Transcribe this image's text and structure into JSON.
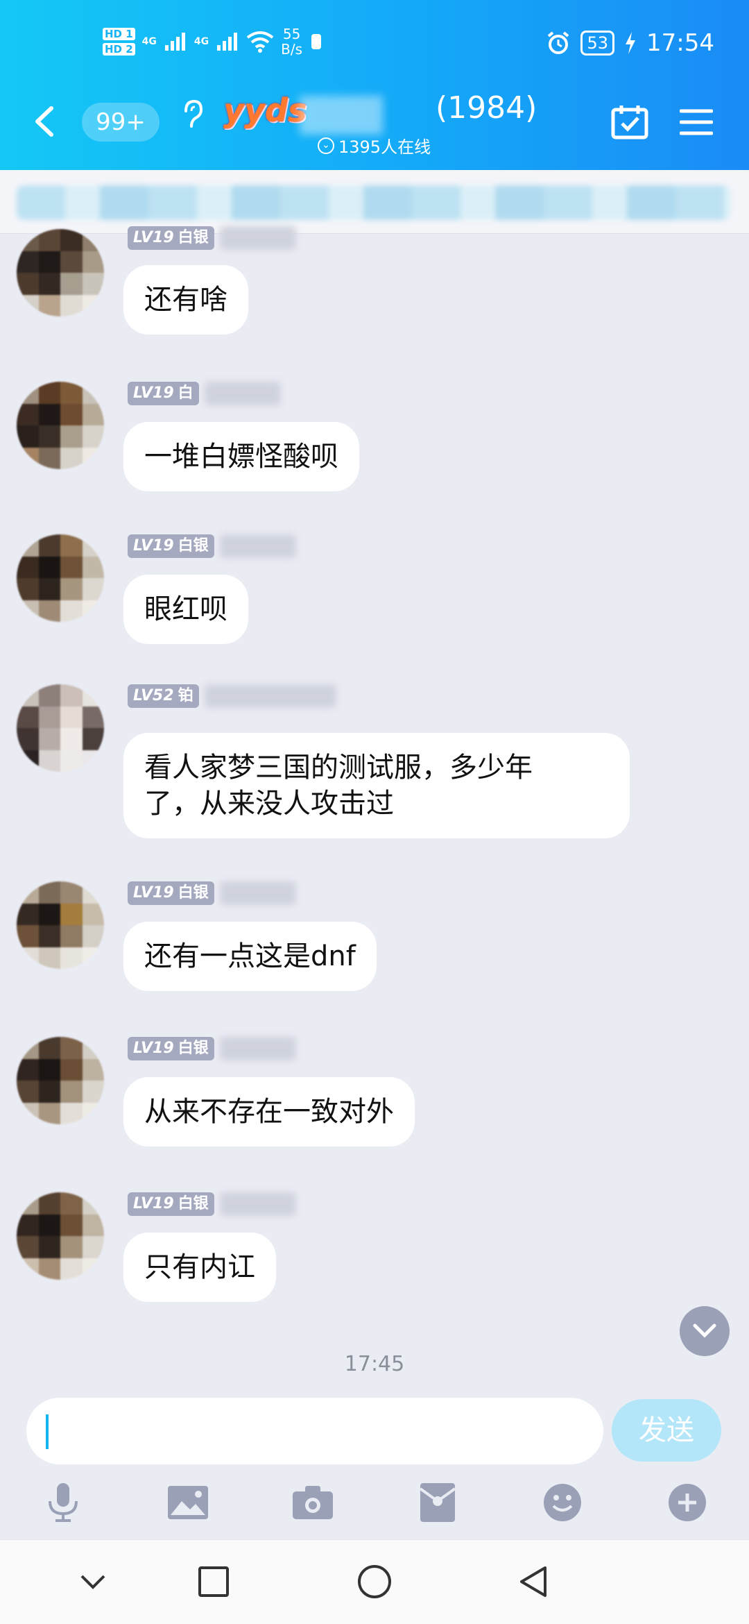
{
  "status_bar": {
    "hd1": "HD 1",
    "hd2": "HD 2",
    "net1": "4G",
    "net2": "4G",
    "speed_value": "55",
    "speed_unit": "B/s",
    "battery": "53",
    "time": "17:54"
  },
  "header": {
    "unread_badge": "99+",
    "group_logo": "yyds",
    "member_count": "(1984)",
    "online_text": "1395人在线"
  },
  "messages": [
    {
      "level": "LV19",
      "rank": "白银",
      "text": "还有啥"
    },
    {
      "level": "LV19",
      "rank": "白",
      "text": "一堆白嫖怪酸呗"
    },
    {
      "level": "LV19",
      "rank": "白银",
      "text": "眼红呗"
    },
    {
      "level": "LV52",
      "rank": "铂",
      "text_line1": "看人家梦三国的测试服，多少年",
      "text_line2": "了，从来没人攻击过"
    },
    {
      "level": "LV19",
      "rank": "白银",
      "text": "还有一点这是dnf"
    },
    {
      "level": "LV19",
      "rank": "白银",
      "text": "从来不存在一致对外"
    },
    {
      "level": "LV19",
      "rank": "白银",
      "text": "只有内讧"
    }
  ],
  "timestamp": "17:45",
  "input": {
    "value": "",
    "send_label": "发送"
  },
  "toolbar_icons": [
    "microphone-icon",
    "image-icon",
    "camera-icon",
    "red-packet-icon",
    "emoji-icon",
    "plus-icon"
  ],
  "colors": {
    "header_start": "#14c8f6",
    "header_end": "#1a8cf6",
    "chat_bg": "#eaecf4",
    "send_disabled": "#b4e6fa",
    "level_tag": "#a4a9bf"
  }
}
